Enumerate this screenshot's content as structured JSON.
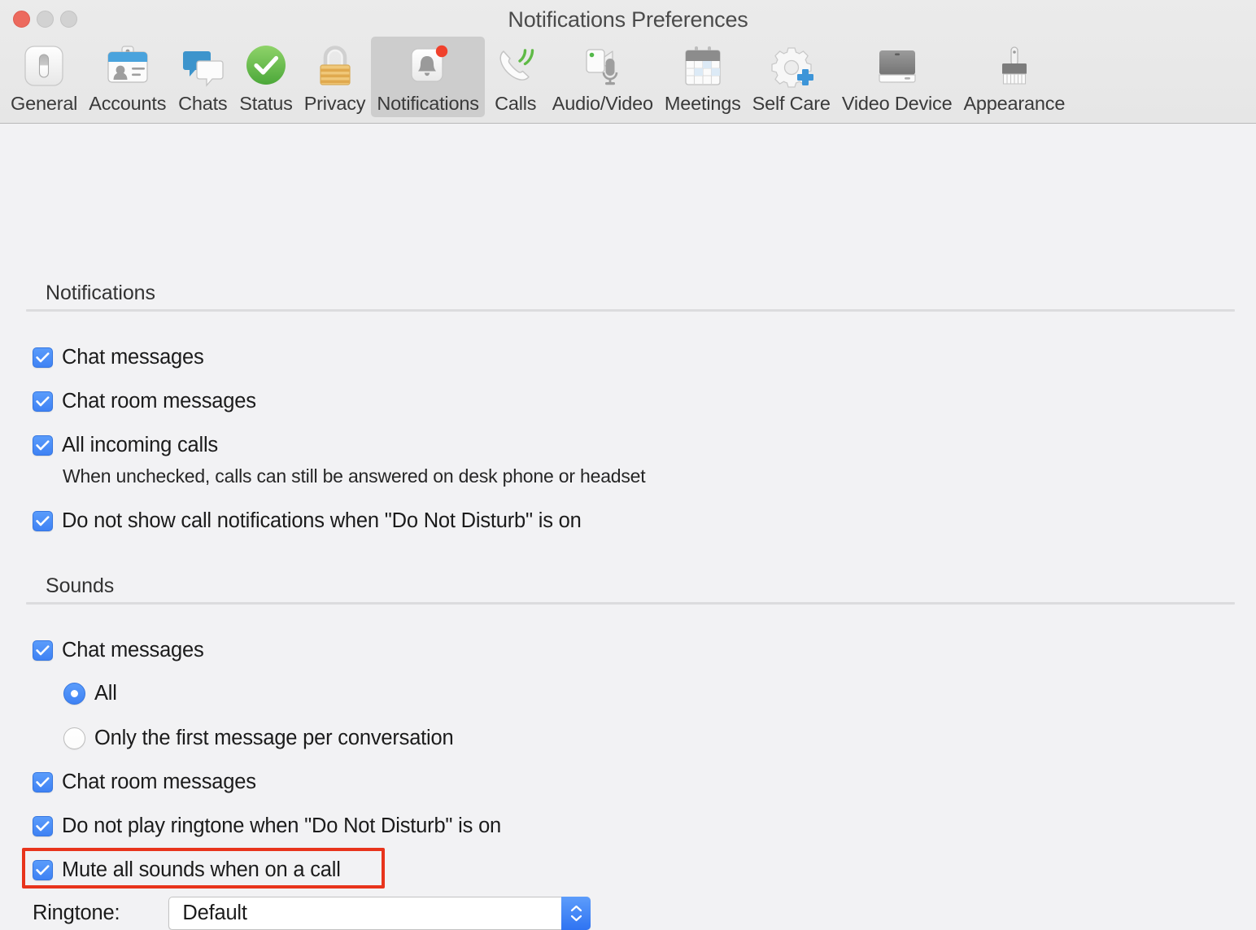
{
  "window": {
    "title": "Notifications Preferences",
    "traffic_lights": [
      {
        "name": "close",
        "color": "#ec6a5e"
      },
      {
        "name": "minimize",
        "color": "#d2d2d2"
      },
      {
        "name": "zoom",
        "color": "#d2d2d2"
      }
    ]
  },
  "toolbar": {
    "selected": "Notifications",
    "items": [
      {
        "label": "General",
        "icon": "general-icon"
      },
      {
        "label": "Accounts",
        "icon": "accounts-icon"
      },
      {
        "label": "Chats",
        "icon": "chats-icon"
      },
      {
        "label": "Status",
        "icon": "status-icon"
      },
      {
        "label": "Privacy",
        "icon": "privacy-lock-icon"
      },
      {
        "label": "Notifications",
        "icon": "notifications-bell-icon"
      },
      {
        "label": "Calls",
        "icon": "calls-phone-icon"
      },
      {
        "label": "Audio/Video",
        "icon": "audio-video-icon"
      },
      {
        "label": "Meetings",
        "icon": "meetings-calendar-icon"
      },
      {
        "label": "Self Care",
        "icon": "self-care-gear-plus-icon"
      },
      {
        "label": "Video Device",
        "icon": "video-device-monitor-icon"
      },
      {
        "label": "Appearance",
        "icon": "appearance-brush-icon"
      }
    ]
  },
  "sections": {
    "notifications": {
      "title": "Notifications",
      "checkboxes": [
        {
          "label": "Chat messages",
          "checked": true
        },
        {
          "label": "Chat room messages",
          "checked": true
        },
        {
          "label": "All incoming calls",
          "checked": true
        },
        {
          "label": "Do not show call notifications when \"Do Not Disturb\" is on",
          "checked": true
        }
      ],
      "help_text": "When unchecked, calls can still be answered on desk phone or headset"
    },
    "sounds": {
      "title": "Sounds",
      "chat_messages": {
        "label": "Chat messages",
        "checked": true
      },
      "radios": [
        {
          "label": "All",
          "selected": true
        },
        {
          "label": "Only the first message per conversation",
          "selected": false
        }
      ],
      "chat_room_messages": {
        "label": "Chat room messages",
        "checked": true
      },
      "do_not_play_ringtone": {
        "label": "Do not play ringtone when \"Do Not Disturb\" is on",
        "checked": true
      },
      "mute_all_sounds": {
        "label": "Mute all sounds when on a call",
        "checked": true,
        "highlighted": true
      },
      "ringtone": {
        "label": "Ringtone:",
        "value": "Default",
        "options": [
          "Default"
        ]
      }
    }
  },
  "annotation": {
    "color": "#e8341c",
    "target": "Mute all sounds when on a call"
  },
  "colors": {
    "accent": "#3f82f4",
    "toolbar_bg": "#e8e8e8",
    "content_bg": "#f2f2f4",
    "selected_tab_bg": "#cdcdcd",
    "annotation": "#e8341c"
  }
}
